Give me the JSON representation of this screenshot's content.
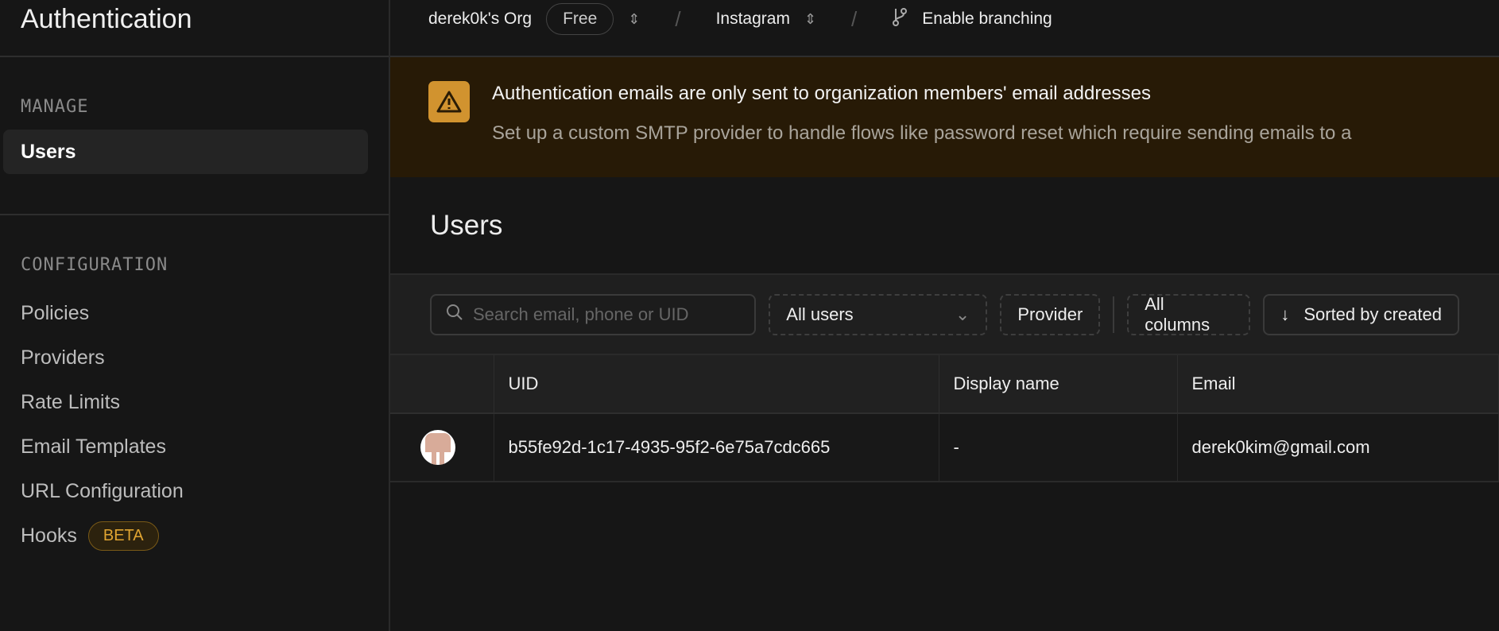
{
  "sidebar": {
    "title": "Authentication",
    "manage_label": "MANAGE",
    "manage_items": [
      {
        "label": "Users"
      }
    ],
    "config_label": "CONFIGURATION",
    "config_items": [
      {
        "label": "Policies"
      },
      {
        "label": "Providers"
      },
      {
        "label": "Rate Limits"
      },
      {
        "label": "Email Templates"
      },
      {
        "label": "URL Configuration"
      },
      {
        "label": "Hooks",
        "badge": "BETA"
      }
    ]
  },
  "topbar": {
    "org": "derek0k's Org",
    "plan": "Free",
    "project": "Instagram",
    "branching": "Enable branching"
  },
  "banner": {
    "title": "Authentication emails are only sent to organization members' email addresses",
    "body": "Set up a custom SMTP provider to handle flows like password reset which require sending emails to a"
  },
  "page": {
    "title": "Users"
  },
  "toolbar": {
    "search_placeholder": "Search email, phone or UID",
    "filter": "All users",
    "provider": "Provider",
    "columns": "All columns",
    "sort": "Sorted by created"
  },
  "table": {
    "headers": [
      "UID",
      "Display name",
      "Email"
    ],
    "rows": [
      {
        "uid": "b55fe92d-1c17-4935-95f2-6e75a7cdc665",
        "display_name": "-",
        "email": "derek0kim@gmail.com"
      }
    ]
  },
  "colors": {
    "accent": "#d1932f",
    "banner_bg": "#271a06"
  }
}
